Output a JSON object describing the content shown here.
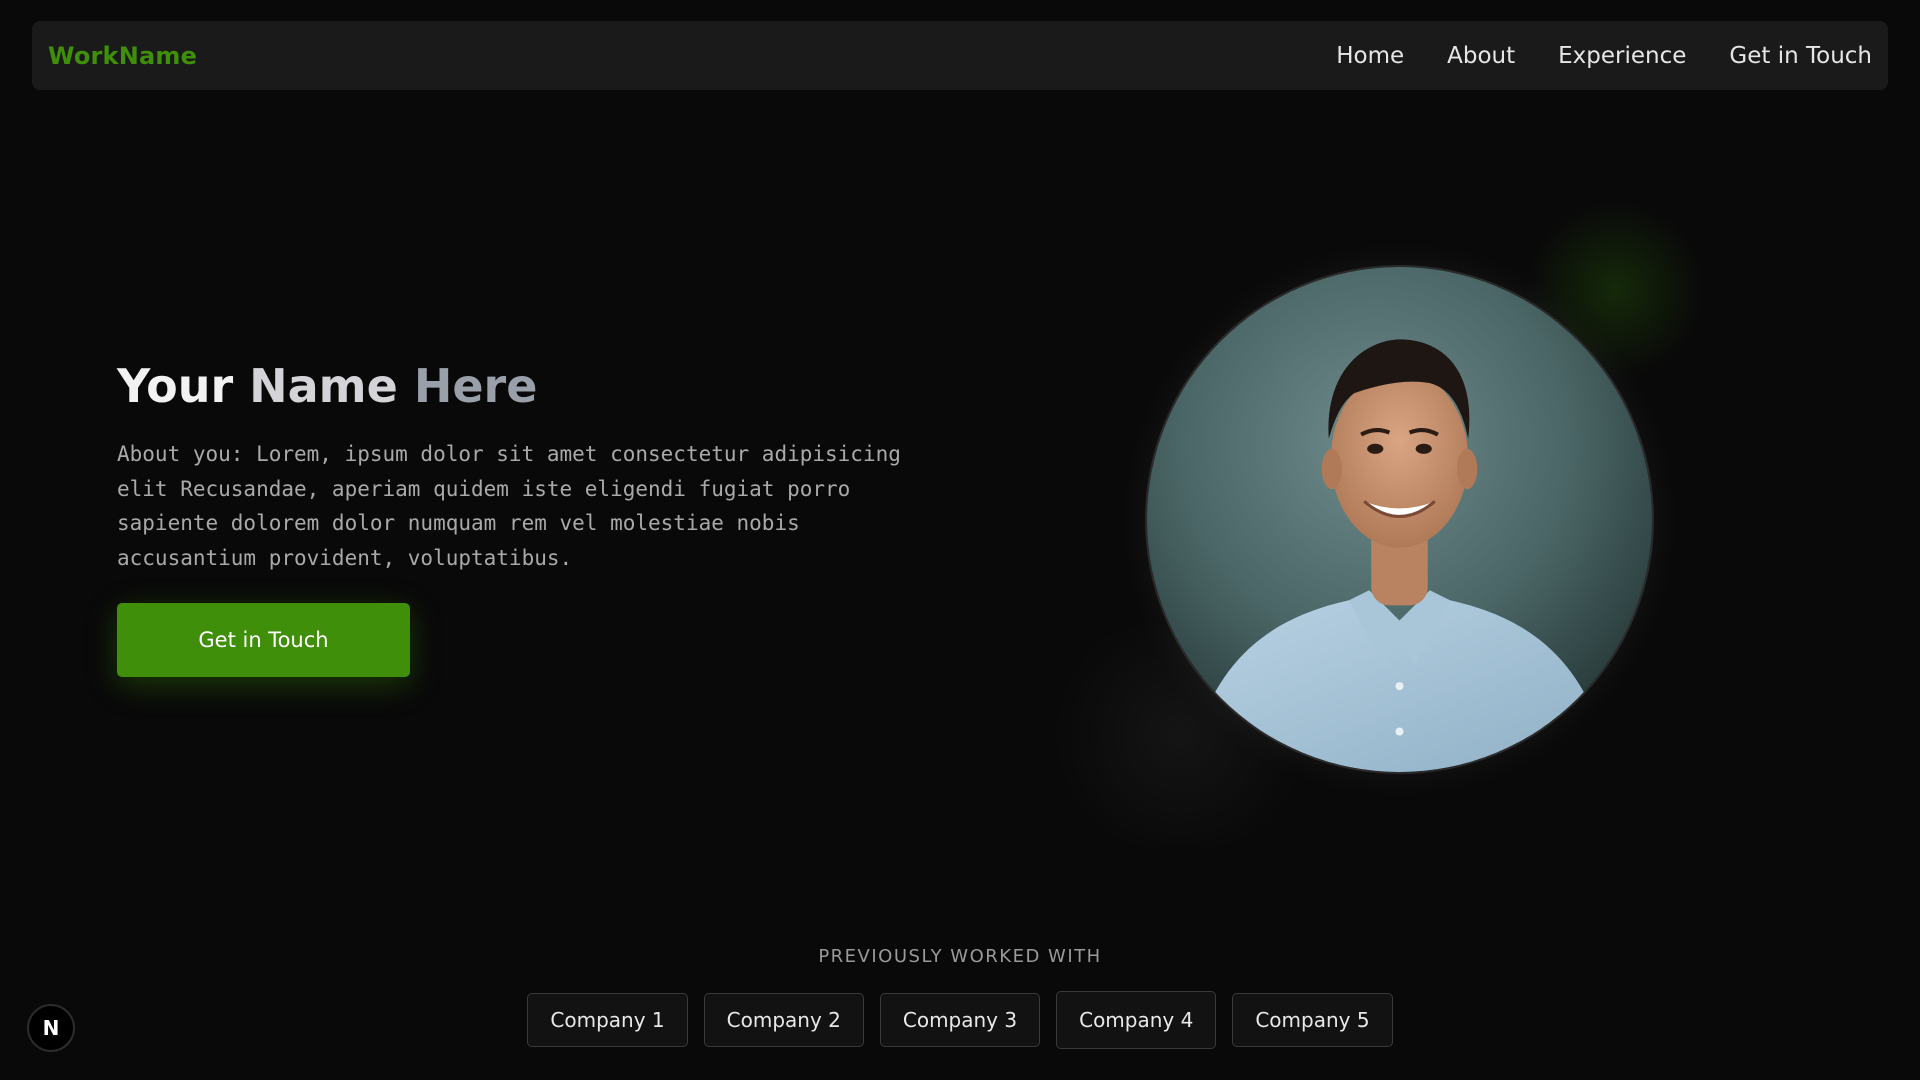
{
  "header": {
    "logo": "WorkName",
    "nav": [
      "Home",
      "About",
      "Experience",
      "Get in Touch"
    ]
  },
  "hero": {
    "title_parts": [
      "Your",
      "Name",
      "Here"
    ],
    "about": "About you: Lorem, ipsum dolor sit amet consectetur adipisicing elit Recusandae, aperiam quidem iste eligendi fugiat porro sapiente dolorem dolor numquam rem vel molestiae nobis accusantium provident, voluptatibus.",
    "cta_label": "Get in Touch",
    "portrait_alt": "portrait-photo"
  },
  "companies": {
    "label": "PREVIOUSLY WORKED WITH",
    "items": [
      "Company 1",
      "Company 2",
      "Company 3",
      "Company 4",
      "Company 5"
    ]
  },
  "badge": {
    "label": "N",
    "icon": "nextjs-logo-icon"
  },
  "colors": {
    "background": "#090909",
    "navbar": "#1a1a1a",
    "accent": "#3f8f0a",
    "text": "#e8e8e8",
    "muted": "#a9a9a9"
  }
}
